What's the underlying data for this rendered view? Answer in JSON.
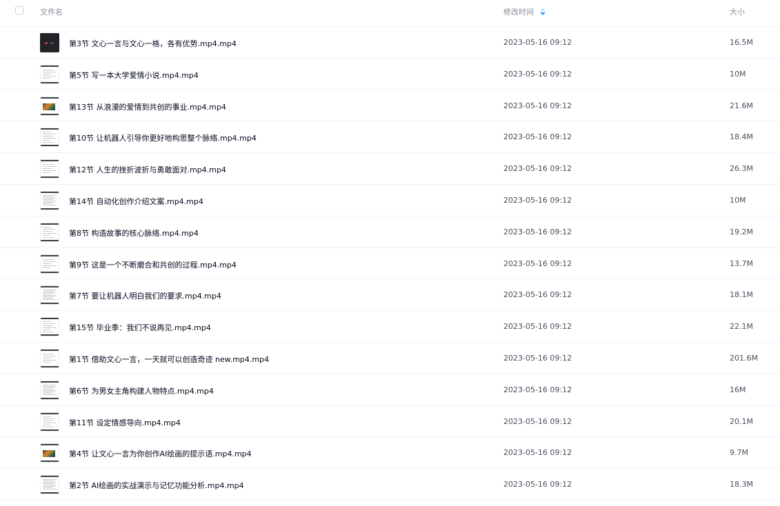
{
  "header": {
    "name_label": "文件名",
    "time_label": "修改时间",
    "size_label": "大小",
    "sort_icon": "sort-desc-icon",
    "sort_active_color": "#2a95ff"
  },
  "files": [
    {
      "name": "第3节 文心一言与文心一格，各有优势.mp4.mp4",
      "time": "2023-05-16 09:12",
      "size": "16.5M",
      "thumb": "dark"
    },
    {
      "name": "第5节 写一本大学爱情小说.mp4.mp4",
      "time": "2023-05-16 09:12",
      "size": "10M",
      "thumb": "doc"
    },
    {
      "name": "第13节 从浪漫的爱情到共创的事业.mp4.mp4",
      "time": "2023-05-16 09:12",
      "size": "21.6M",
      "thumb": "pic"
    },
    {
      "name": "第10节 让机器人引导你更好地构思整个脉络.mp4.mp4",
      "time": "2023-05-16 09:12",
      "size": "18.4M",
      "thumb": "doc"
    },
    {
      "name": "第12节 人生的挫折波折与勇敢面对.mp4.mp4",
      "time": "2023-05-16 09:12",
      "size": "26.3M",
      "thumb": "doc"
    },
    {
      "name": "第14节 自动化创作介绍文案.mp4.mp4",
      "time": "2023-05-16 09:12",
      "size": "10M",
      "thumb": "doc"
    },
    {
      "name": "第8节 构造故事的核心脉络.mp4.mp4",
      "time": "2023-05-16 09:12",
      "size": "19.2M",
      "thumb": "doc"
    },
    {
      "name": "第9节 这是一个不断磨合和共创的过程.mp4.mp4",
      "time": "2023-05-16 09:12",
      "size": "13.7M",
      "thumb": "doc"
    },
    {
      "name": "第7节 要让机器人明白我们的要求.mp4.mp4",
      "time": "2023-05-16 09:12",
      "size": "18.1M",
      "thumb": "doc"
    },
    {
      "name": "第15节 毕业季：我们不说再见.mp4.mp4",
      "time": "2023-05-16 09:12",
      "size": "22.1M",
      "thumb": "doc"
    },
    {
      "name": "第1节 借助文心一言，一天就可以创造奇迹 new.mp4.mp4",
      "time": "2023-05-16 09:12",
      "size": "201.6M",
      "thumb": "doc"
    },
    {
      "name": "第6节 为男女主角构建人物特点.mp4.mp4",
      "time": "2023-05-16 09:12",
      "size": "16M",
      "thumb": "doc"
    },
    {
      "name": "第11节 设定情感导向.mp4.mp4",
      "time": "2023-05-16 09:12",
      "size": "20.1M",
      "thumb": "doc"
    },
    {
      "name": "第4节 让文心一言为你创作AI绘画的提示语.mp4.mp4",
      "time": "2023-05-16 09:12",
      "size": "9.7M",
      "thumb": "pic"
    },
    {
      "name": "第2节 AI绘画的实战演示与记忆功能分析.mp4.mp4",
      "time": "2023-05-16 09:12",
      "size": "18.3M",
      "thumb": "doc"
    }
  ]
}
